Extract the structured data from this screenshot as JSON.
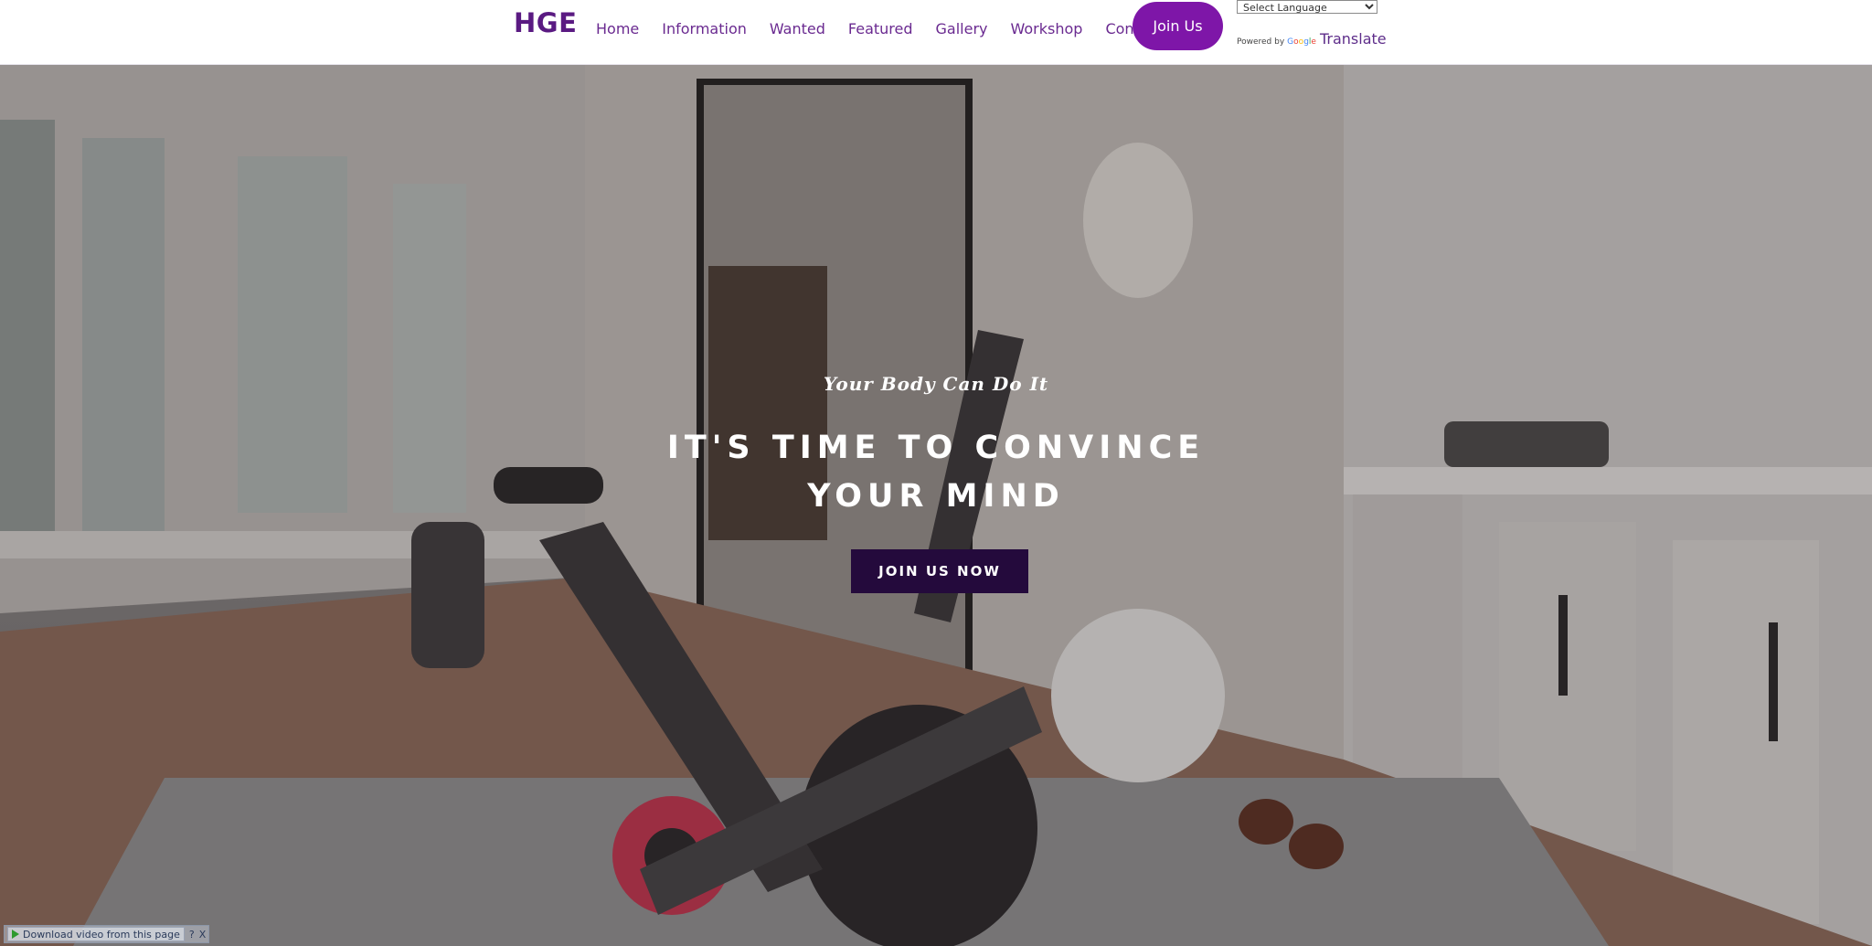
{
  "header": {
    "logo": "HGE",
    "nav": [
      "Home",
      "Information",
      "Wanted",
      "Featured",
      "Gallery",
      "Workshop",
      "Contact"
    ],
    "join_button": "Join Us",
    "language_select": {
      "selected": "Select Language"
    },
    "powered_by": "Powered by",
    "google_mark": "Google",
    "translate_link": "Translate"
  },
  "hero": {
    "tagline": "Your Body Can Do It",
    "headline": "IT'S TIME TO CONVINCE YOUR MIND",
    "cta": "JOIN US NOW"
  },
  "video_bar": {
    "download_label": "Download video from this page",
    "help": "?",
    "close": "X"
  },
  "colors": {
    "brand_purple": "#5a1a82",
    "nav_purple": "#6a2a90",
    "join_button_bg": "#7e16a8",
    "cta_bg": "#240a3c"
  },
  "icons": {
    "play": "play-icon",
    "help": "help-icon",
    "close": "close-icon"
  }
}
